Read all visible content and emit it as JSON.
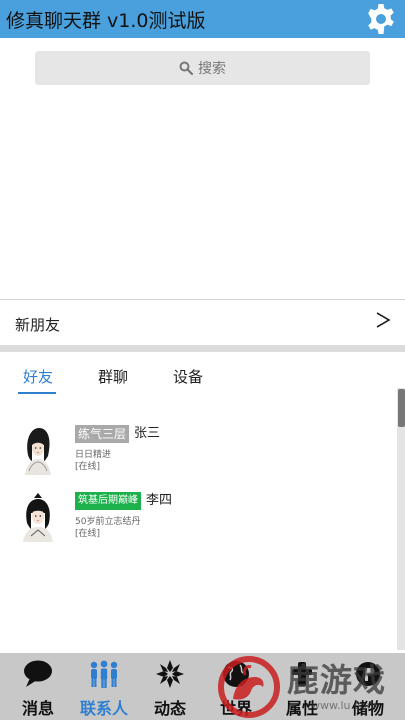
{
  "header": {
    "title": "修真聊天群 v1.0测试版",
    "settings_icon": "gear-icon",
    "bg_color": "#4aa0dc"
  },
  "search": {
    "icon": "search-icon",
    "placeholder": "搜索"
  },
  "new_friends": {
    "label": "新朋友",
    "chevron": ">"
  },
  "tabs": [
    {
      "label": "好友",
      "active": true
    },
    {
      "label": "群聊",
      "active": false
    },
    {
      "label": "设备",
      "active": false
    }
  ],
  "friends": [
    {
      "rank": "练气三层",
      "rank_color": "#a9a9a9",
      "name": "张三",
      "motto": "日日精进",
      "status": "[在线]"
    },
    {
      "rank": "筑基后期巅峰",
      "rank_color": "#1db14b",
      "name": "李四",
      "motto": "50岁前立志结丹",
      "status": "[在线]"
    }
  ],
  "bottom_nav": [
    {
      "label": "消息",
      "icon": "chat-bubble-icon",
      "active": false
    },
    {
      "label": "联系人",
      "icon": "contacts-icon",
      "active": true
    },
    {
      "label": "动态",
      "icon": "snowflake-icon",
      "active": false
    },
    {
      "label": "世界",
      "icon": "globe-icon",
      "active": false
    },
    {
      "label": "属性",
      "icon": "attribute-icon",
      "active": false
    },
    {
      "label": "储物",
      "icon": "storage-icon",
      "active": false
    }
  ],
  "watermark": {
    "text": "鹿游戏",
    "url": "www.lu.com"
  },
  "colors": {
    "accent": "#2f7fd1",
    "nav_bg": "#c8c8c8"
  }
}
